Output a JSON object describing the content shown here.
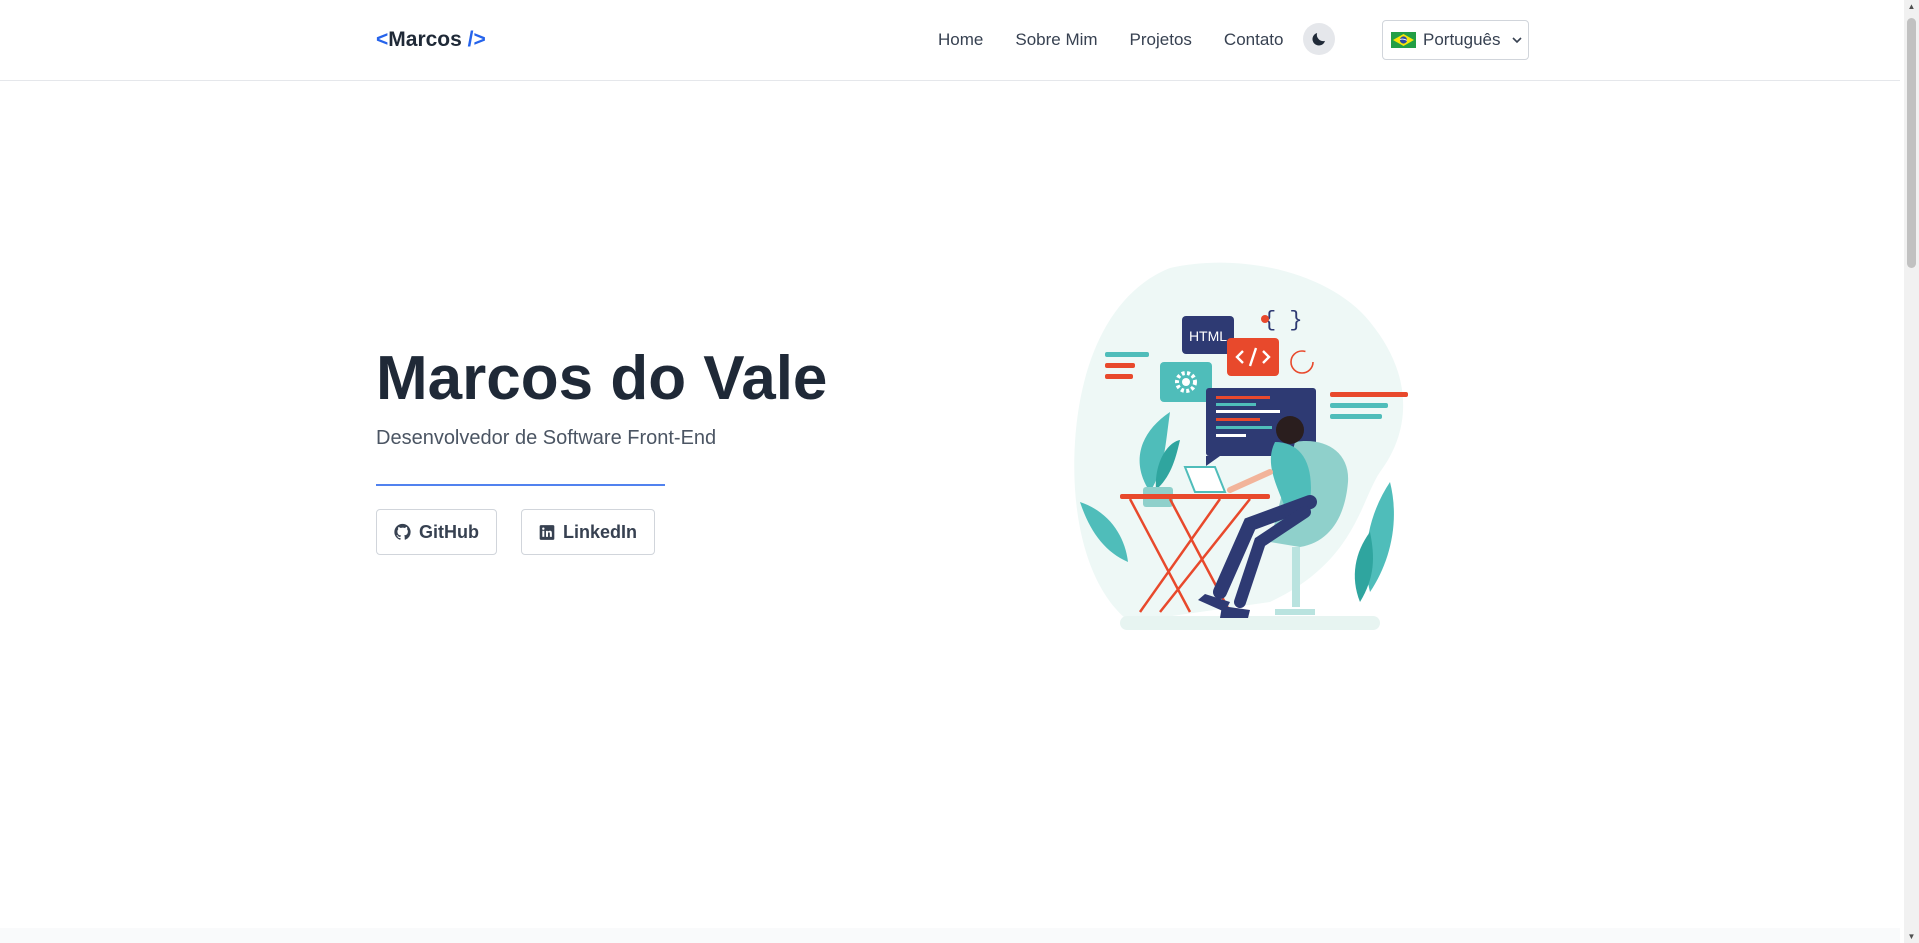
{
  "header": {
    "logo": {
      "open": "<",
      "name": "Marcos",
      "close": " />"
    },
    "nav": [
      "Home",
      "Sobre Mim",
      "Projetos",
      "Contato"
    ],
    "theme_icon": "moon-icon",
    "language": {
      "label": "Português",
      "flag_icon": "brazil-flag-icon",
      "chevron_icon": "chevron-down-icon"
    }
  },
  "hero": {
    "title": "Marcos do Vale",
    "subtitle": "Desenvolvedor de Software Front-End",
    "buttons": [
      {
        "label": "GitHub",
        "icon": "github-icon"
      },
      {
        "label": "LinkedIn",
        "icon": "linkedin-icon"
      }
    ],
    "illustration": {
      "badge_text": "HTML"
    }
  },
  "colors": {
    "accent": "#2563eb",
    "text": "#1f2937",
    "teal": "#4fbdba",
    "orange": "#e8492c",
    "navy": "#2e3a73"
  }
}
